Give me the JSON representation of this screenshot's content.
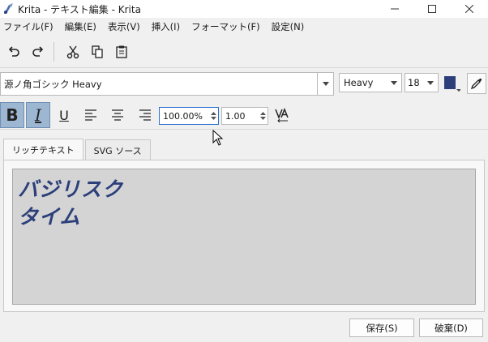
{
  "window": {
    "title": "Krita - テキスト編集 - Krita"
  },
  "menu": [
    {
      "label": "ファイル(F)",
      "name": "menu-file"
    },
    {
      "label": "編集(E)",
      "name": "menu-edit"
    },
    {
      "label": "表示(V)",
      "name": "menu-view"
    },
    {
      "label": "挿入(I)",
      "name": "menu-insert"
    },
    {
      "label": "フォーマット(F)",
      "name": "menu-format"
    },
    {
      "label": "設定(N)",
      "name": "menu-settings"
    }
  ],
  "font": {
    "family": "源ノ角ゴシック Heavy",
    "weight": "Heavy",
    "size": "18",
    "color": "#2c3f7a"
  },
  "format": {
    "letter_spacing": "100.00%",
    "line_height": "1.00",
    "bold_active": true,
    "italic_active": true
  },
  "tabs": [
    {
      "label": "リッチテキスト",
      "active": true
    },
    {
      "label": "SVG ソース",
      "active": false
    }
  ],
  "editor": {
    "lines": [
      "バジリスク",
      "タイム"
    ]
  },
  "buttons": {
    "save": "保存(S)",
    "discard": "破棄(D)"
  }
}
